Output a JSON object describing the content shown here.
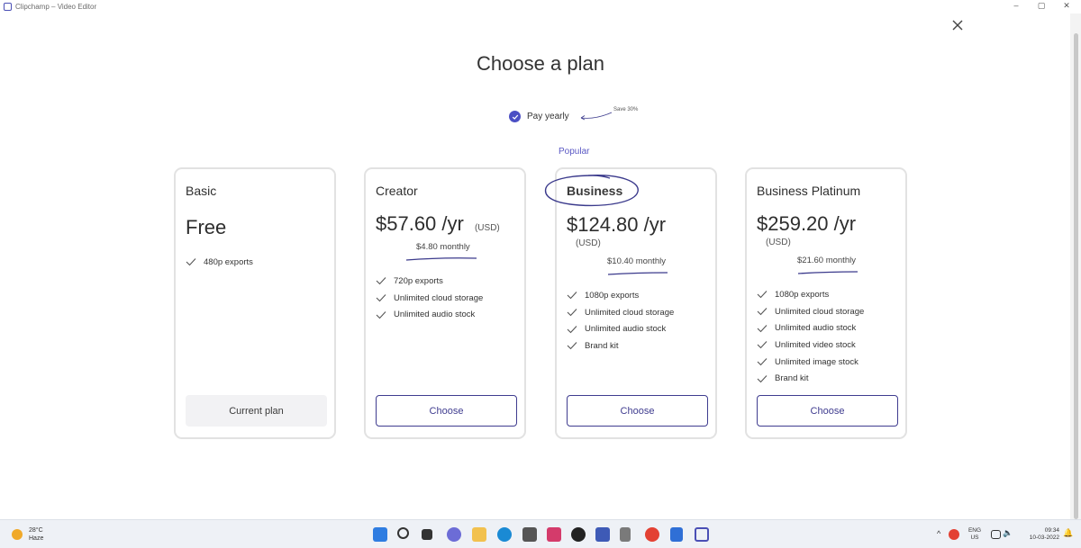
{
  "window": {
    "title": "Clipchamp – Video Editor"
  },
  "heading": "Choose a plan",
  "billing": {
    "toggle_label": "Pay yearly",
    "save_note": "Save 30%",
    "popular_label": "Popular"
  },
  "plans": [
    {
      "name": "Basic",
      "price": "Free",
      "currency": "",
      "monthly": "",
      "features": [
        "480p exports"
      ],
      "button": "Current plan"
    },
    {
      "name": "Creator",
      "price": "$57.60 /yr",
      "currency": "(USD)",
      "monthly": "$4.80 monthly",
      "features": [
        "720p exports",
        "Unlimited cloud storage",
        "Unlimited audio stock"
      ],
      "button": "Choose"
    },
    {
      "name": "Business",
      "price": "$124.80 /yr",
      "currency": "(USD)",
      "monthly": "$10.40 monthly",
      "features": [
        "1080p exports",
        "Unlimited cloud storage",
        "Unlimited audio stock",
        "Brand kit"
      ],
      "button": "Choose"
    },
    {
      "name": "Business Platinum",
      "price": "$259.20 /yr",
      "currency": "(USD)",
      "monthly": "$21.60 monthly",
      "features": [
        "1080p exports",
        "Unlimited cloud storage",
        "Unlimited audio stock",
        "Unlimited video stock",
        "Unlimited image stock",
        "Brand kit"
      ],
      "button": "Choose"
    }
  ],
  "taskbar": {
    "weather": {
      "temp": "28°C",
      "condition": "Haze"
    },
    "language": {
      "lang": "ENG",
      "region": "US"
    },
    "clock": {
      "time": "09:34",
      "date": "10-03-2022"
    }
  },
  "colors": {
    "accent": "#4b4fc4",
    "button_border": "#3f3c8f",
    "card_border": "#e2e2e2",
    "annotation_ink": "#3b3a8c"
  }
}
